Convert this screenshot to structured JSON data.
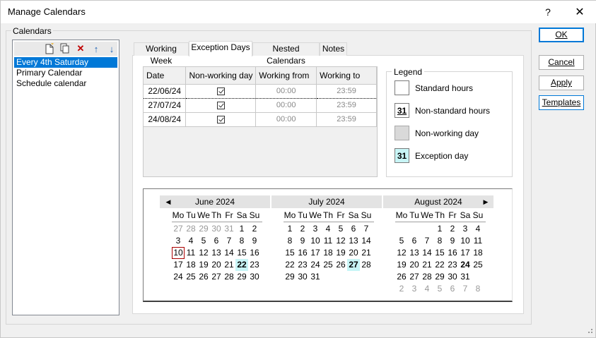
{
  "window": {
    "title": "Manage Calendars",
    "help_label": "?",
    "close_label": "✕"
  },
  "group": {
    "label": "Calendars"
  },
  "calendar_list": {
    "toolbar_icons": [
      "new-document-icon",
      "copy-icon",
      "delete-icon",
      "move-up-icon",
      "move-down-icon"
    ],
    "items": [
      {
        "label": "Every 4th Saturday",
        "selected": true
      },
      {
        "label": "Primary Calendar",
        "selected": false
      },
      {
        "label": "Schedule calendar",
        "selected": false
      }
    ]
  },
  "tabs": [
    {
      "label": "Working Week",
      "active": false
    },
    {
      "label": "Exception Days",
      "active": true
    },
    {
      "label": "Nested Calendars",
      "active": false
    },
    {
      "label": "Notes",
      "active": false
    }
  ],
  "exceptions_table": {
    "headers": [
      "Date",
      "Non-working day",
      "Working from",
      "Working to"
    ],
    "rows": [
      {
        "date": "22/06/24",
        "non_working": true,
        "from": "00:00",
        "to": "23:59"
      },
      {
        "date": "27/07/24",
        "non_working": true,
        "from": "00:00",
        "to": "23:59"
      },
      {
        "date": "24/08/24",
        "non_working": true,
        "from": "00:00",
        "to": "23:59"
      }
    ]
  },
  "legend": {
    "title": "Legend",
    "items": [
      {
        "label": "Standard hours",
        "swatch_text": "",
        "swatch_color": "#ffffff"
      },
      {
        "label": "Non-standard hours",
        "swatch_text": "31",
        "swatch_color": "#ffffff"
      },
      {
        "label": "Non-working day",
        "swatch_text": "",
        "swatch_color": "#d9d9d9"
      },
      {
        "label": "Exception day",
        "swatch_text": "31",
        "swatch_color": "#c8f5f6"
      }
    ]
  },
  "calendar_view": {
    "prev_label": "◀",
    "next_label": "▶",
    "weekdays": [
      "Mo",
      "Tu",
      "We",
      "Th",
      "Fr",
      "Sa",
      "Su"
    ],
    "months": [
      {
        "title": "June 2024",
        "weeks": [
          [
            [
              "27",
              "other"
            ],
            [
              "28",
              "other"
            ],
            [
              "29",
              "other"
            ],
            [
              "30",
              "other"
            ],
            [
              "31",
              "other"
            ],
            [
              "1",
              ""
            ],
            [
              "2",
              ""
            ]
          ],
          [
            [
              "3",
              ""
            ],
            [
              "4",
              ""
            ],
            [
              "5",
              ""
            ],
            [
              "6",
              ""
            ],
            [
              "7",
              ""
            ],
            [
              "8",
              ""
            ],
            [
              "9",
              ""
            ]
          ],
          [
            [
              "10",
              "today"
            ],
            [
              "11",
              ""
            ],
            [
              "12",
              ""
            ],
            [
              "13",
              ""
            ],
            [
              "14",
              ""
            ],
            [
              "15",
              ""
            ],
            [
              "16",
              ""
            ]
          ],
          [
            [
              "17",
              ""
            ],
            [
              "18",
              ""
            ],
            [
              "19",
              ""
            ],
            [
              "20",
              ""
            ],
            [
              "21",
              ""
            ],
            [
              "22",
              "exc"
            ],
            [
              "23",
              ""
            ]
          ],
          [
            [
              "24",
              ""
            ],
            [
              "25",
              ""
            ],
            [
              "26",
              ""
            ],
            [
              "27",
              ""
            ],
            [
              "28",
              ""
            ],
            [
              "29",
              ""
            ],
            [
              "30",
              ""
            ]
          ]
        ]
      },
      {
        "title": "July 2024",
        "weeks": [
          [
            [
              "1",
              ""
            ],
            [
              "2",
              ""
            ],
            [
              "3",
              ""
            ],
            [
              "4",
              ""
            ],
            [
              "5",
              ""
            ],
            [
              "6",
              ""
            ],
            [
              "7",
              ""
            ]
          ],
          [
            [
              "8",
              ""
            ],
            [
              "9",
              ""
            ],
            [
              "10",
              ""
            ],
            [
              "11",
              ""
            ],
            [
              "12",
              ""
            ],
            [
              "13",
              ""
            ],
            [
              "14",
              ""
            ]
          ],
          [
            [
              "15",
              ""
            ],
            [
              "16",
              ""
            ],
            [
              "17",
              ""
            ],
            [
              "18",
              ""
            ],
            [
              "19",
              ""
            ],
            [
              "20",
              ""
            ],
            [
              "21",
              ""
            ]
          ],
          [
            [
              "22",
              ""
            ],
            [
              "23",
              ""
            ],
            [
              "24",
              ""
            ],
            [
              "25",
              ""
            ],
            [
              "26",
              ""
            ],
            [
              "27",
              "exc"
            ],
            [
              "28",
              ""
            ]
          ],
          [
            [
              "29",
              ""
            ],
            [
              "30",
              ""
            ],
            [
              "31",
              ""
            ]
          ]
        ]
      },
      {
        "title": "August 2024",
        "weeks": [
          [
            [
              "",
              "blank"
            ],
            [
              "",
              "blank"
            ],
            [
              "",
              "blank"
            ],
            [
              "1",
              ""
            ],
            [
              "2",
              ""
            ],
            [
              "3",
              ""
            ],
            [
              "4",
              ""
            ]
          ],
          [
            [
              "5",
              ""
            ],
            [
              "6",
              ""
            ],
            [
              "7",
              ""
            ],
            [
              "8",
              ""
            ],
            [
              "9",
              ""
            ],
            [
              "10",
              ""
            ],
            [
              "11",
              ""
            ]
          ],
          [
            [
              "12",
              ""
            ],
            [
              "13",
              ""
            ],
            [
              "14",
              ""
            ],
            [
              "15",
              ""
            ],
            [
              "16",
              ""
            ],
            [
              "17",
              ""
            ],
            [
              "18",
              ""
            ]
          ],
          [
            [
              "19",
              ""
            ],
            [
              "20",
              ""
            ],
            [
              "21",
              ""
            ],
            [
              "22",
              ""
            ],
            [
              "23",
              ""
            ],
            [
              "24",
              "bold"
            ],
            [
              "25",
              ""
            ]
          ],
          [
            [
              "26",
              ""
            ],
            [
              "27",
              ""
            ],
            [
              "28",
              ""
            ],
            [
              "29",
              ""
            ],
            [
              "30",
              ""
            ],
            [
              "31",
              ""
            ]
          ],
          [
            [
              "2",
              "other"
            ],
            [
              "3",
              "other"
            ],
            [
              "4",
              "other"
            ],
            [
              "5",
              "other"
            ],
            [
              "6",
              "other"
            ],
            [
              "7",
              "other"
            ],
            [
              "8",
              "other"
            ]
          ]
        ]
      }
    ]
  },
  "buttons": {
    "ok": "OK",
    "cancel": "Cancel",
    "apply": "Apply",
    "templates": "Templates"
  }
}
